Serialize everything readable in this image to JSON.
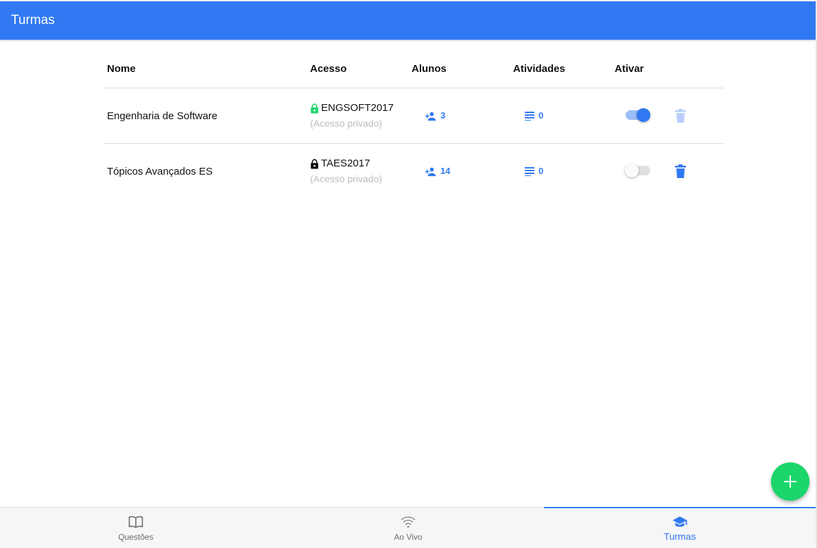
{
  "appbar": {
    "title": "Turmas"
  },
  "colors": {
    "primary": "#3179f3",
    "fab": "#1ad66b",
    "lock_open": "#1ad66b",
    "lock_closed": "#111111"
  },
  "table": {
    "headers": {
      "name": "Nome",
      "access": "Acesso",
      "students": "Alunos",
      "activities": "Atividades",
      "activate": "Ativar"
    },
    "rows": [
      {
        "name": "Engenharia de Software",
        "access_icon": "lock-green-icon",
        "access_code": "ENGSOFT2017",
        "access_type": "(Acesso privado)",
        "students": "3",
        "activities": "0",
        "active": true
      },
      {
        "name": "Tópicos Avançados ES",
        "access_icon": "lock-black-icon",
        "access_code": "TAES2017",
        "access_type": "(Acesso privado)",
        "students": "14",
        "activities": "0",
        "active": false
      }
    ]
  },
  "fab": {
    "icon": "plus-icon"
  },
  "bottom_nav": {
    "items": [
      {
        "label": "Questões",
        "icon": "book-icon",
        "active": false
      },
      {
        "label": "Ao Vivo",
        "icon": "wifi-icon",
        "active": false
      },
      {
        "label": "Turmas",
        "icon": "graduation-cap-icon",
        "active": true
      }
    ]
  }
}
